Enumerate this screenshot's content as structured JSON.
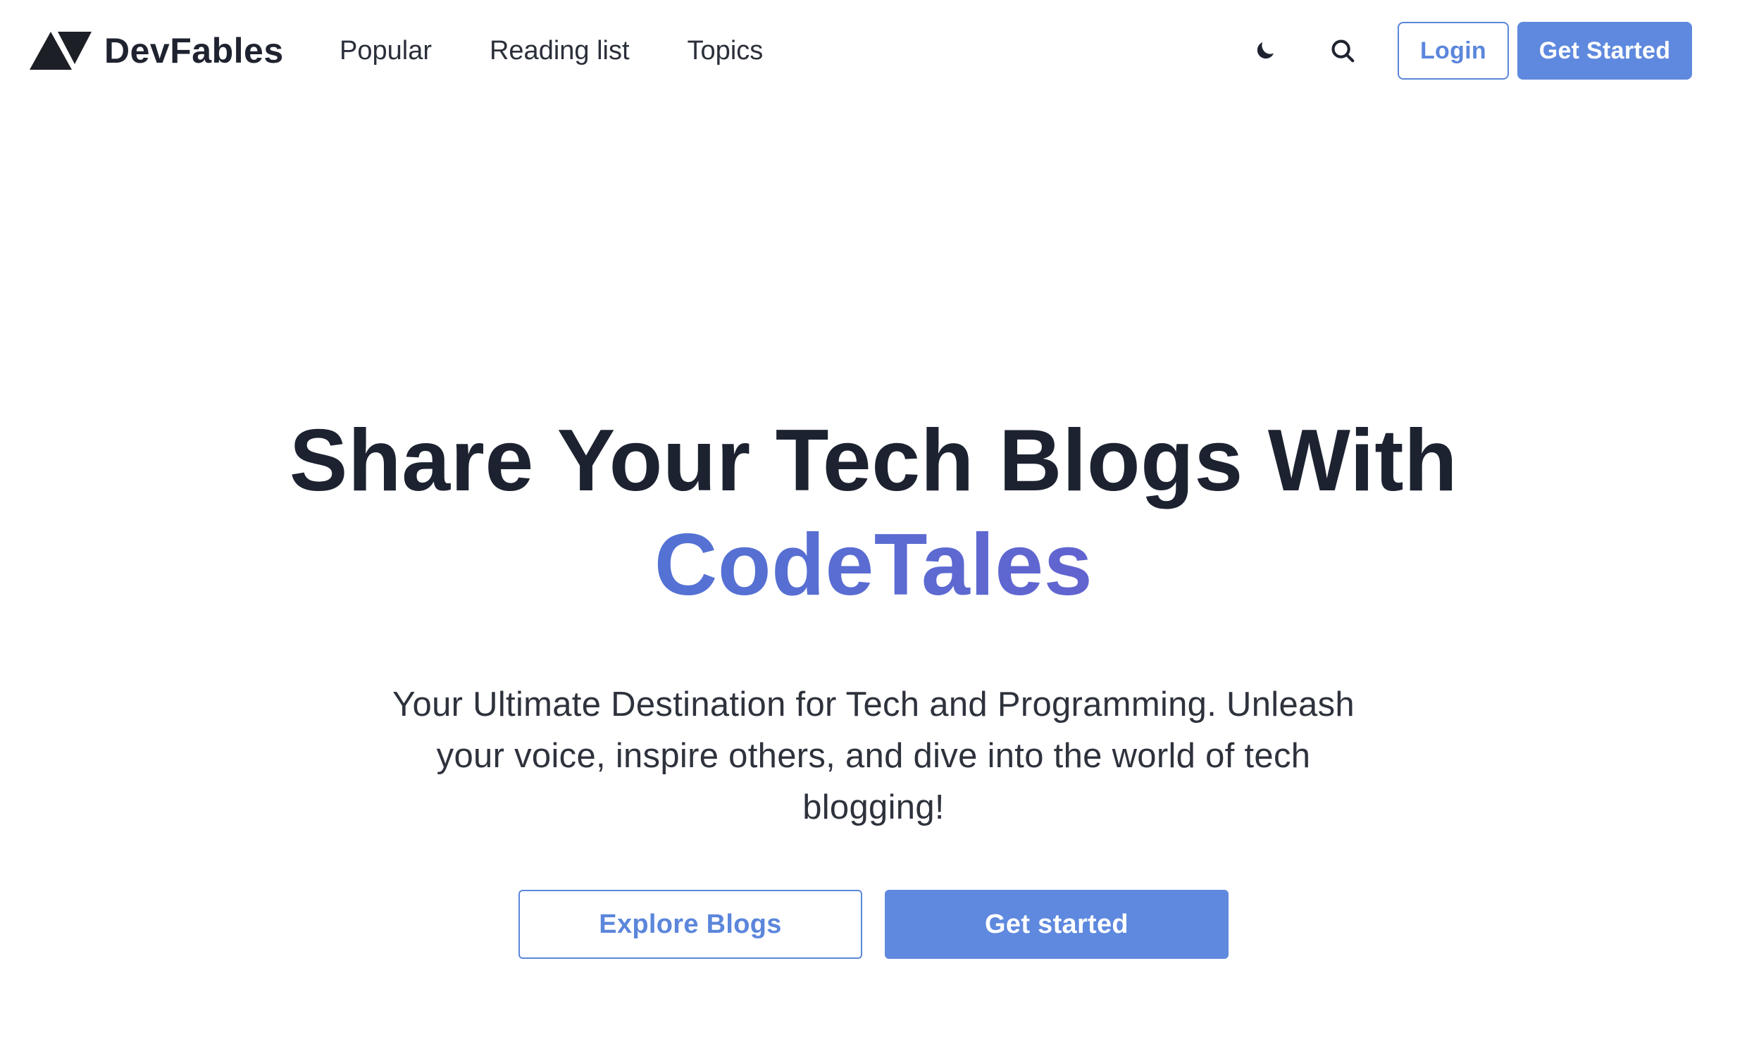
{
  "colors": {
    "accent": "#5f89de",
    "text_dark": "#1c2230",
    "gradient_start": "#3f86d6",
    "gradient_end": "#7849c4",
    "background": "#ffffff"
  },
  "navbar": {
    "logo_icon": "triangle-logo-icon",
    "brand": "DevFables",
    "links": [
      {
        "label": "Popular"
      },
      {
        "label": "Reading list"
      },
      {
        "label": "Topics"
      }
    ],
    "theme_toggle_icon": "moon-icon",
    "search_icon": "search-icon",
    "login_label": "Login",
    "get_started_label": "Get Started"
  },
  "hero": {
    "title_line1": "Share Your Tech Blogs With",
    "title_highlight": "CodeTales",
    "subtitle": "Your Ultimate Destination for Tech and Programming. Unleash your voice, inspire others, and dive into the world of tech blogging!",
    "explore_label": "Explore Blogs",
    "start_label": "Get started"
  }
}
